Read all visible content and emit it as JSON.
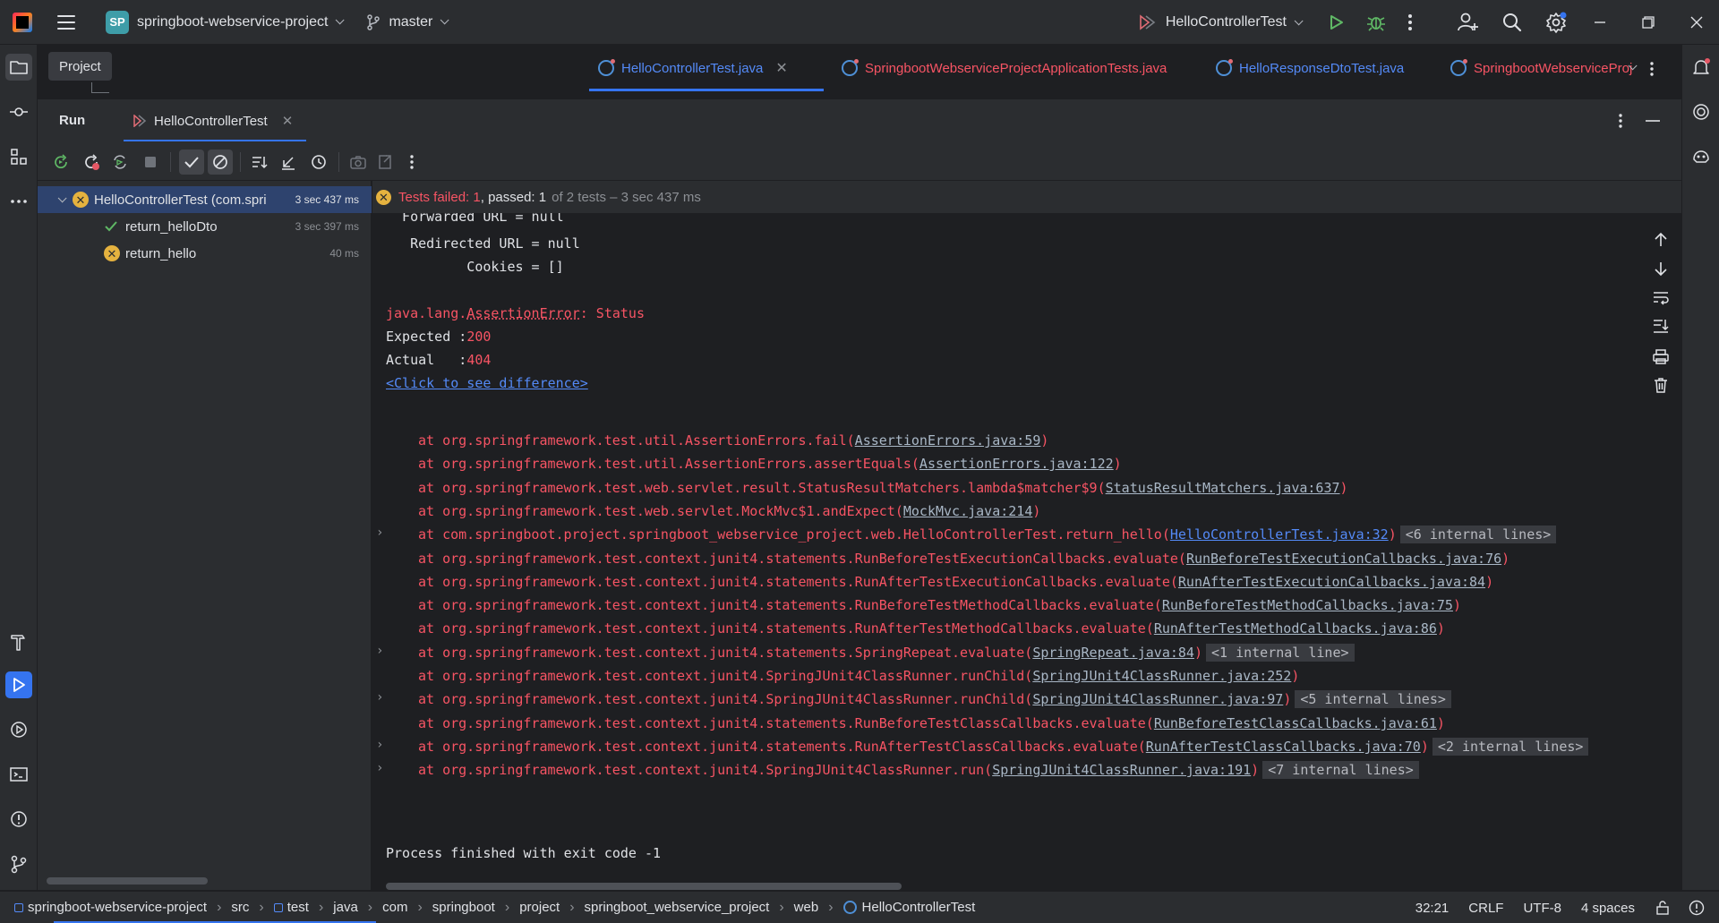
{
  "titlebar": {
    "project_badge": "SP",
    "project_name": "springboot-webservice-project",
    "branch": "master",
    "run_config": "HelloControllerTest"
  },
  "project_tab": "Project",
  "editor_tabs": [
    {
      "label": "HelloControllerTest.java",
      "active": true
    },
    {
      "label": "SpringbootWebserviceProjectApplicationTests.java",
      "active": false
    },
    {
      "label": "HelloResponseDtoTest.java",
      "active": false
    },
    {
      "label": "SpringbootWebserviceProj",
      "active": false
    }
  ],
  "run_panel": {
    "title": "Run",
    "tab_label": "HelloControllerTest"
  },
  "test_tree": {
    "root": {
      "label": "HelloControllerTest (com.spri",
      "time": "3 sec 437 ms",
      "status": "failed"
    },
    "children": [
      {
        "label": "return_helloDto",
        "time": "3 sec 397 ms",
        "status": "passed"
      },
      {
        "label": "return_hello",
        "time": "40 ms",
        "status": "failed"
      }
    ]
  },
  "status_line": {
    "failed": "Tests failed: 1",
    "passed": "passed: 1",
    "rest": "of 2 tests – 3 sec 437 ms"
  },
  "console": {
    "partial_top": "  Forwarded URL = null",
    "redirected": "   Redirected URL = null",
    "cookies": "          Cookies = []",
    "error_prefix": "java.lang.",
    "error_class": "AssertionError",
    "error_msg": ": Status",
    "expected_label": "Expected :",
    "expected_value": "200",
    "actual_label": "Actual   :",
    "actual_value": "404",
    "diff_link": "<Click to see difference>",
    "stack": [
      {
        "text": "at org.springframework.test.util.AssertionErrors.fail(",
        "link": "AssertionErrors.java:59",
        "tail": ")",
        "internal": "",
        "expandable": false,
        "blue": false
      },
      {
        "text": "at org.springframework.test.util.AssertionErrors.assertEquals(",
        "link": "AssertionErrors.java:122",
        "tail": ")",
        "internal": "",
        "expandable": false,
        "blue": false
      },
      {
        "text": "at org.springframework.test.web.servlet.result.StatusResultMatchers.lambda$matcher$9(",
        "link": "StatusResultMatchers.java:637",
        "tail": ")",
        "internal": "",
        "expandable": false,
        "blue": false
      },
      {
        "text": "at org.springframework.test.web.servlet.MockMvc$1.andExpect(",
        "link": "MockMvc.java:214",
        "tail": ")",
        "internal": "",
        "expandable": false,
        "blue": false
      },
      {
        "text": "at com.springboot.project.springboot_webservice_project.web.HelloControllerTest.return_hello(",
        "link": "HelloControllerTest.java:32",
        "tail": ")",
        "internal": "<6 internal lines>",
        "expandable": true,
        "blue": true
      },
      {
        "text": "at org.springframework.test.context.junit4.statements.RunBeforeTestExecutionCallbacks.evaluate(",
        "link": "RunBeforeTestExecutionCallbacks.java:76",
        "tail": ")",
        "internal": "",
        "expandable": false,
        "blue": false
      },
      {
        "text": "at org.springframework.test.context.junit4.statements.RunAfterTestExecutionCallbacks.evaluate(",
        "link": "RunAfterTestExecutionCallbacks.java:84",
        "tail": ")",
        "internal": "",
        "expandable": false,
        "blue": false
      },
      {
        "text": "at org.springframework.test.context.junit4.statements.RunBeforeTestMethodCallbacks.evaluate(",
        "link": "RunBeforeTestMethodCallbacks.java:75",
        "tail": ")",
        "internal": "",
        "expandable": false,
        "blue": false
      },
      {
        "text": "at org.springframework.test.context.junit4.statements.RunAfterTestMethodCallbacks.evaluate(",
        "link": "RunAfterTestMethodCallbacks.java:86",
        "tail": ")",
        "internal": "",
        "expandable": false,
        "blue": false
      },
      {
        "text": "at org.springframework.test.context.junit4.statements.SpringRepeat.evaluate(",
        "link": "SpringRepeat.java:84",
        "tail": ")",
        "internal": "<1 internal line>",
        "expandable": true,
        "blue": false
      },
      {
        "text": "at org.springframework.test.context.junit4.SpringJUnit4ClassRunner.runChild(",
        "link": "SpringJUnit4ClassRunner.java:252",
        "tail": ")",
        "internal": "",
        "expandable": false,
        "blue": false
      },
      {
        "text": "at org.springframework.test.context.junit4.SpringJUnit4ClassRunner.runChild(",
        "link": "SpringJUnit4ClassRunner.java:97",
        "tail": ")",
        "internal": "<5 internal lines>",
        "expandable": true,
        "blue": false
      },
      {
        "text": "at org.springframework.test.context.junit4.statements.RunBeforeTestClassCallbacks.evaluate(",
        "link": "RunBeforeTestClassCallbacks.java:61",
        "tail": ")",
        "internal": "",
        "expandable": false,
        "blue": false
      },
      {
        "text": "at org.springframework.test.context.junit4.statements.RunAfterTestClassCallbacks.evaluate(",
        "link": "RunAfterTestClassCallbacks.java:70",
        "tail": ")",
        "internal": "<2 internal lines>",
        "expandable": true,
        "blue": false
      },
      {
        "text": "at org.springframework.test.context.junit4.SpringJUnit4ClassRunner.run(",
        "link": "SpringJUnit4ClassRunner.java:191",
        "tail": ")",
        "internal": "<7 internal lines>",
        "expandable": true,
        "blue": false
      }
    ],
    "process_finished": "Process finished with exit code -1"
  },
  "breadcrumbs": [
    "springboot-webservice-project",
    "src",
    "test",
    "java",
    "com",
    "springboot",
    "project",
    "springboot_webservice_project",
    "web",
    "HelloControllerTest"
  ],
  "statusbar": {
    "position": "32:21",
    "line_sep": "CRLF",
    "encoding": "UTF-8",
    "indent": "4 spaces"
  },
  "colors": {
    "accent": "#3574f0",
    "error": "#f75464",
    "passed": "#5fb865",
    "warning": "#e5b23f"
  }
}
